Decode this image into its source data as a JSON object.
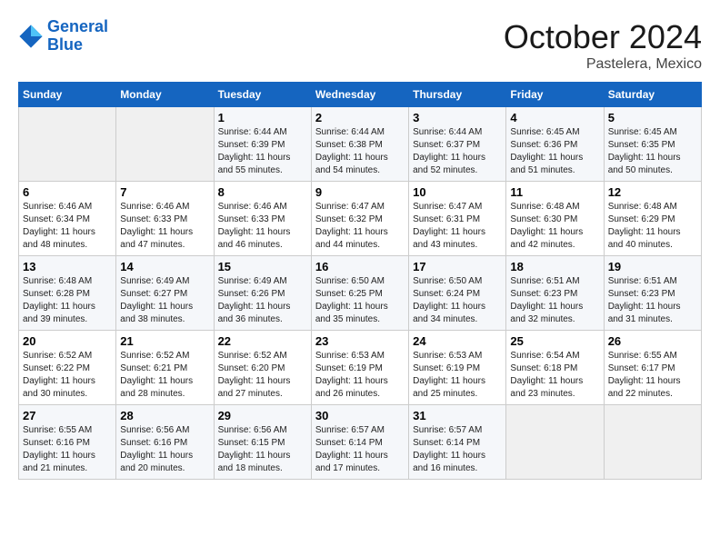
{
  "header": {
    "logo_line1": "General",
    "logo_line2": "Blue",
    "month": "October 2024",
    "location": "Pastelera, Mexico"
  },
  "weekdays": [
    "Sunday",
    "Monday",
    "Tuesday",
    "Wednesday",
    "Thursday",
    "Friday",
    "Saturday"
  ],
  "weeks": [
    [
      {
        "day": "",
        "sunrise": "",
        "sunset": "",
        "daylight": ""
      },
      {
        "day": "",
        "sunrise": "",
        "sunset": "",
        "daylight": ""
      },
      {
        "day": "1",
        "sunrise": "Sunrise: 6:44 AM",
        "sunset": "Sunset: 6:39 PM",
        "daylight": "Daylight: 11 hours and 55 minutes."
      },
      {
        "day": "2",
        "sunrise": "Sunrise: 6:44 AM",
        "sunset": "Sunset: 6:38 PM",
        "daylight": "Daylight: 11 hours and 54 minutes."
      },
      {
        "day": "3",
        "sunrise": "Sunrise: 6:44 AM",
        "sunset": "Sunset: 6:37 PM",
        "daylight": "Daylight: 11 hours and 52 minutes."
      },
      {
        "day": "4",
        "sunrise": "Sunrise: 6:45 AM",
        "sunset": "Sunset: 6:36 PM",
        "daylight": "Daylight: 11 hours and 51 minutes."
      },
      {
        "day": "5",
        "sunrise": "Sunrise: 6:45 AM",
        "sunset": "Sunset: 6:35 PM",
        "daylight": "Daylight: 11 hours and 50 minutes."
      }
    ],
    [
      {
        "day": "6",
        "sunrise": "Sunrise: 6:46 AM",
        "sunset": "Sunset: 6:34 PM",
        "daylight": "Daylight: 11 hours and 48 minutes."
      },
      {
        "day": "7",
        "sunrise": "Sunrise: 6:46 AM",
        "sunset": "Sunset: 6:33 PM",
        "daylight": "Daylight: 11 hours and 47 minutes."
      },
      {
        "day": "8",
        "sunrise": "Sunrise: 6:46 AM",
        "sunset": "Sunset: 6:33 PM",
        "daylight": "Daylight: 11 hours and 46 minutes."
      },
      {
        "day": "9",
        "sunrise": "Sunrise: 6:47 AM",
        "sunset": "Sunset: 6:32 PM",
        "daylight": "Daylight: 11 hours and 44 minutes."
      },
      {
        "day": "10",
        "sunrise": "Sunrise: 6:47 AM",
        "sunset": "Sunset: 6:31 PM",
        "daylight": "Daylight: 11 hours and 43 minutes."
      },
      {
        "day": "11",
        "sunrise": "Sunrise: 6:48 AM",
        "sunset": "Sunset: 6:30 PM",
        "daylight": "Daylight: 11 hours and 42 minutes."
      },
      {
        "day": "12",
        "sunrise": "Sunrise: 6:48 AM",
        "sunset": "Sunset: 6:29 PM",
        "daylight": "Daylight: 11 hours and 40 minutes."
      }
    ],
    [
      {
        "day": "13",
        "sunrise": "Sunrise: 6:48 AM",
        "sunset": "Sunset: 6:28 PM",
        "daylight": "Daylight: 11 hours and 39 minutes."
      },
      {
        "day": "14",
        "sunrise": "Sunrise: 6:49 AM",
        "sunset": "Sunset: 6:27 PM",
        "daylight": "Daylight: 11 hours and 38 minutes."
      },
      {
        "day": "15",
        "sunrise": "Sunrise: 6:49 AM",
        "sunset": "Sunset: 6:26 PM",
        "daylight": "Daylight: 11 hours and 36 minutes."
      },
      {
        "day": "16",
        "sunrise": "Sunrise: 6:50 AM",
        "sunset": "Sunset: 6:25 PM",
        "daylight": "Daylight: 11 hours and 35 minutes."
      },
      {
        "day": "17",
        "sunrise": "Sunrise: 6:50 AM",
        "sunset": "Sunset: 6:24 PM",
        "daylight": "Daylight: 11 hours and 34 minutes."
      },
      {
        "day": "18",
        "sunrise": "Sunrise: 6:51 AM",
        "sunset": "Sunset: 6:23 PM",
        "daylight": "Daylight: 11 hours and 32 minutes."
      },
      {
        "day": "19",
        "sunrise": "Sunrise: 6:51 AM",
        "sunset": "Sunset: 6:23 PM",
        "daylight": "Daylight: 11 hours and 31 minutes."
      }
    ],
    [
      {
        "day": "20",
        "sunrise": "Sunrise: 6:52 AM",
        "sunset": "Sunset: 6:22 PM",
        "daylight": "Daylight: 11 hours and 30 minutes."
      },
      {
        "day": "21",
        "sunrise": "Sunrise: 6:52 AM",
        "sunset": "Sunset: 6:21 PM",
        "daylight": "Daylight: 11 hours and 28 minutes."
      },
      {
        "day": "22",
        "sunrise": "Sunrise: 6:52 AM",
        "sunset": "Sunset: 6:20 PM",
        "daylight": "Daylight: 11 hours and 27 minutes."
      },
      {
        "day": "23",
        "sunrise": "Sunrise: 6:53 AM",
        "sunset": "Sunset: 6:19 PM",
        "daylight": "Daylight: 11 hours and 26 minutes."
      },
      {
        "day": "24",
        "sunrise": "Sunrise: 6:53 AM",
        "sunset": "Sunset: 6:19 PM",
        "daylight": "Daylight: 11 hours and 25 minutes."
      },
      {
        "day": "25",
        "sunrise": "Sunrise: 6:54 AM",
        "sunset": "Sunset: 6:18 PM",
        "daylight": "Daylight: 11 hours and 23 minutes."
      },
      {
        "day": "26",
        "sunrise": "Sunrise: 6:55 AM",
        "sunset": "Sunset: 6:17 PM",
        "daylight": "Daylight: 11 hours and 22 minutes."
      }
    ],
    [
      {
        "day": "27",
        "sunrise": "Sunrise: 6:55 AM",
        "sunset": "Sunset: 6:16 PM",
        "daylight": "Daylight: 11 hours and 21 minutes."
      },
      {
        "day": "28",
        "sunrise": "Sunrise: 6:56 AM",
        "sunset": "Sunset: 6:16 PM",
        "daylight": "Daylight: 11 hours and 20 minutes."
      },
      {
        "day": "29",
        "sunrise": "Sunrise: 6:56 AM",
        "sunset": "Sunset: 6:15 PM",
        "daylight": "Daylight: 11 hours and 18 minutes."
      },
      {
        "day": "30",
        "sunrise": "Sunrise: 6:57 AM",
        "sunset": "Sunset: 6:14 PM",
        "daylight": "Daylight: 11 hours and 17 minutes."
      },
      {
        "day": "31",
        "sunrise": "Sunrise: 6:57 AM",
        "sunset": "Sunset: 6:14 PM",
        "daylight": "Daylight: 11 hours and 16 minutes."
      },
      {
        "day": "",
        "sunrise": "",
        "sunset": "",
        "daylight": ""
      },
      {
        "day": "",
        "sunrise": "",
        "sunset": "",
        "daylight": ""
      }
    ]
  ]
}
